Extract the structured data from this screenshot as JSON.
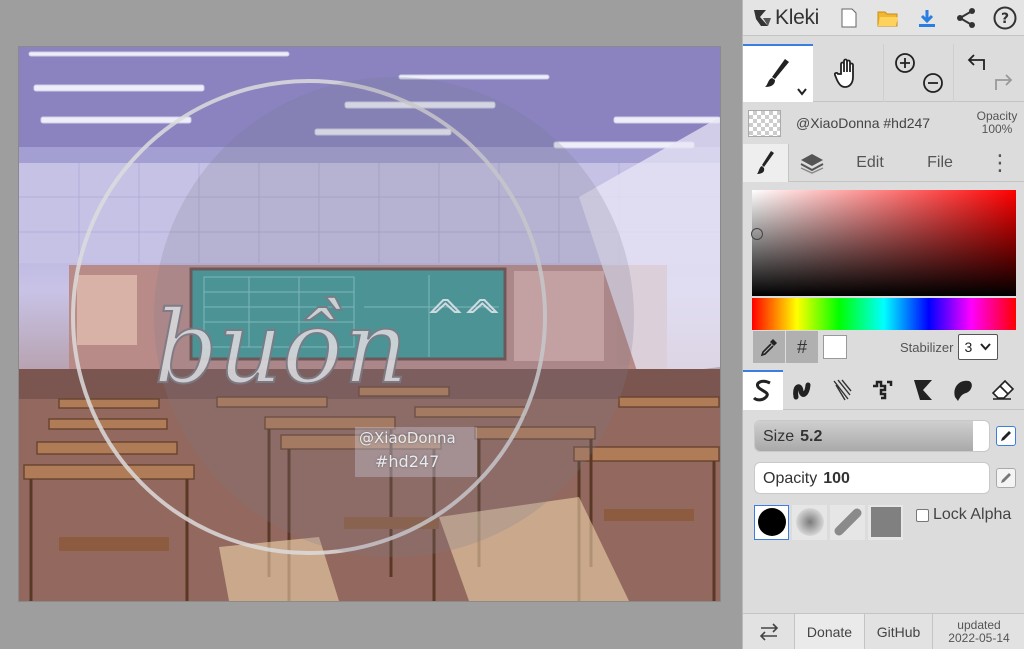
{
  "app": {
    "name": "Kleki"
  },
  "layer": {
    "name": "@XiaoDonna #hd247",
    "opacity_label": "Opacity",
    "opacity_value": "100%"
  },
  "tabs": {
    "edit": "Edit",
    "file": "File",
    "more": "⋮"
  },
  "color": {
    "hex_label": "#",
    "current": "#ffffff"
  },
  "stabilizer": {
    "label": "Stabilizer",
    "value": "3"
  },
  "brush": {
    "size_label": "Size",
    "size_value": "5.2",
    "size_fraction": 0.93,
    "opacity_label": "Opacity",
    "opacity_value": "100",
    "opacity_fraction": 0.0
  },
  "lock_alpha": {
    "label": "Lock Alpha",
    "checked": false
  },
  "footer": {
    "donate": "Donate",
    "github": "GitHub",
    "updated_label": "updated",
    "updated_date": "2022-05-14"
  },
  "watermark": {
    "script_text": "buồn",
    "user": "@XiaoDonna",
    "tag": "#hd247",
    "emote": "^^"
  }
}
